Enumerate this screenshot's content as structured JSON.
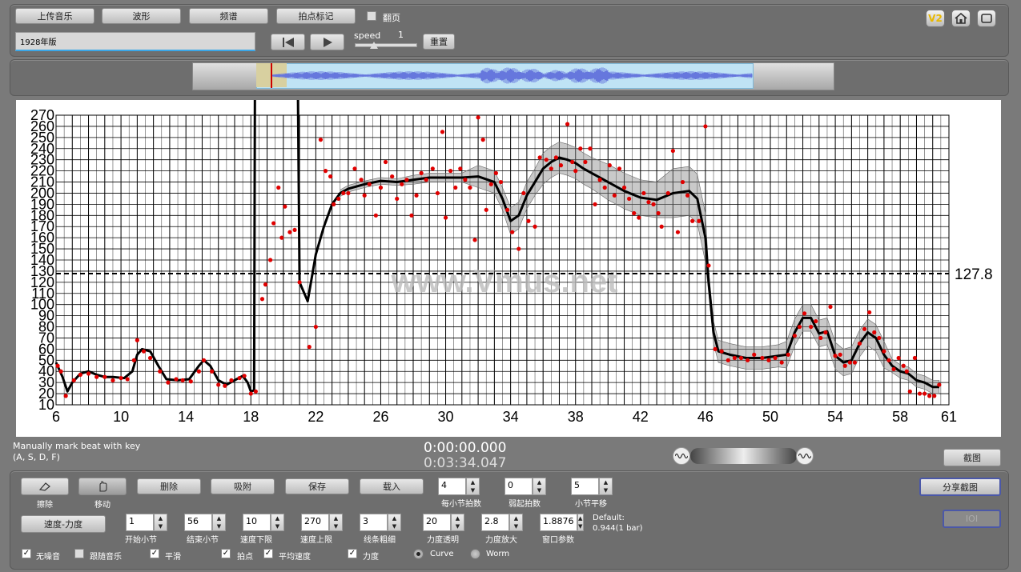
{
  "toolbar": {
    "upload_label": "上传音乐",
    "waveform_label": "波形",
    "spectrum_label": "频谱",
    "beatmark_label": "拍点标记",
    "flip_label": "翻页",
    "version_label": "V2",
    "title_value": "1928年版",
    "speed_label": "speed",
    "speed_value": "1",
    "reset_label": "重置"
  },
  "status": {
    "hint_line1": "Manually mark beat with key",
    "hint_line2": "(A, S, D, F)",
    "time_current": "0:00:00.000",
    "time_total": "0:03:34.047",
    "screenshot_label": "截图"
  },
  "controls": {
    "erase_label": "擦除",
    "move_label": "移动",
    "delete_label": "删除",
    "snap_label": "吸附",
    "save_label": "保存",
    "load_label": "载入",
    "beats_per_bar": {
      "value": "4",
      "label": "每小节拍数"
    },
    "pickup_beats": {
      "value": "0",
      "label": "弱起拍数"
    },
    "bar_shift": {
      "value": "5",
      "label": "小节平移"
    },
    "share_label": "分享截图",
    "ioi_label": "IOI",
    "mode_label": "速度-力度",
    "start_bar": {
      "value": "1",
      "label": "开始小节"
    },
    "end_bar": {
      "value": "56",
      "label": "结束小节"
    },
    "tempo_min": {
      "value": "10",
      "label": "速度下限"
    },
    "tempo_max": {
      "value": "270",
      "label": "速度上限"
    },
    "line_width": {
      "value": "3",
      "label": "线条粗细"
    },
    "dyn_alpha": {
      "value": "20",
      "label": "力度透明"
    },
    "dyn_scale": {
      "value": "2.8",
      "label": "力度放大"
    },
    "window_param": {
      "value": "1.8876",
      "label": "窗口参数"
    },
    "default_line1": "Default:",
    "default_line2": "0.944(1 bar)",
    "checks": {
      "no_noise": "无噪音",
      "follow_music": "跟随音乐",
      "smooth": "平滑",
      "beats": "拍点",
      "avg_tempo": "平均速度",
      "dynamics": "力度"
    },
    "curve_label": "Curve",
    "worm_label": "Worm"
  },
  "chart_data": {
    "type": "scatter",
    "title": "",
    "xlabel": "",
    "ylabel": "",
    "xlim": [
      6,
      61
    ],
    "ylim": [
      10,
      270
    ],
    "x_ticks": [
      6,
      10,
      14,
      18,
      22,
      26,
      30,
      34,
      38,
      42,
      46,
      50,
      54,
      58,
      61
    ],
    "y_ticks": [
      10,
      20,
      30,
      40,
      50,
      60,
      70,
      80,
      90,
      100,
      110,
      120,
      130,
      140,
      150,
      160,
      170,
      180,
      190,
      200,
      210,
      220,
      230,
      240,
      250,
      260,
      270
    ],
    "avg_tempo": 127.8,
    "avg_tempo_label": "127.8",
    "watermark": "www.Vmus.net",
    "grid": true,
    "smooth_curve": [
      [
        6,
        48
      ],
      [
        6.4,
        35
      ],
      [
        6.7,
        22
      ],
      [
        7,
        30
      ],
      [
        7.5,
        38
      ],
      [
        8,
        40
      ],
      [
        8.5,
        37
      ],
      [
        9,
        35
      ],
      [
        9.5,
        35
      ],
      [
        10.2,
        34
      ],
      [
        10.7,
        40
      ],
      [
        11,
        55
      ],
      [
        11.3,
        60
      ],
      [
        11.8,
        58
      ],
      [
        12.3,
        45
      ],
      [
        12.8,
        33
      ],
      [
        13.5,
        32
      ],
      [
        14.2,
        33
      ],
      [
        14.8,
        45
      ],
      [
        15.1,
        50
      ],
      [
        15.5,
        45
      ],
      [
        16,
        32
      ],
      [
        16.5,
        28
      ],
      [
        17,
        32
      ],
      [
        17.5,
        36
      ],
      [
        17.8,
        30
      ],
      [
        18,
        22
      ],
      [
        18.2,
        23
      ],
      [
        18.25,
        270
      ],
      [
        20.9,
        270
      ],
      [
        21,
        120
      ],
      [
        21.5,
        103
      ],
      [
        22,
        145
      ],
      [
        22.5,
        170
      ],
      [
        23,
        190
      ],
      [
        23.5,
        200
      ],
      [
        24,
        204
      ],
      [
        25,
        208
      ],
      [
        26,
        211
      ],
      [
        27,
        210
      ],
      [
        28,
        212
      ],
      [
        29,
        214
      ],
      [
        30,
        214
      ],
      [
        31,
        214
      ],
      [
        32,
        215
      ],
      [
        33,
        210
      ],
      [
        33.5,
        195
      ],
      [
        34,
        175
      ],
      [
        34.5,
        180
      ],
      [
        35,
        198
      ],
      [
        35.5,
        210
      ],
      [
        36,
        222
      ],
      [
        36.5,
        228
      ],
      [
        37,
        232
      ],
      [
        37.5,
        230
      ],
      [
        38,
        227
      ],
      [
        38.5,
        222
      ],
      [
        39,
        218
      ],
      [
        40,
        210
      ],
      [
        41,
        202
      ],
      [
        42,
        196
      ],
      [
        43,
        194
      ],
      [
        44,
        200
      ],
      [
        45,
        202
      ],
      [
        45.5,
        195
      ],
      [
        46,
        160
      ],
      [
        46.2,
        120
      ],
      [
        46.5,
        75
      ],
      [
        46.8,
        58
      ],
      [
        47.5,
        55
      ],
      [
        48.5,
        52
      ],
      [
        49.5,
        52
      ],
      [
        50.5,
        54
      ],
      [
        51,
        55
      ],
      [
        51.5,
        75
      ],
      [
        52,
        88
      ],
      [
        52.5,
        88
      ],
      [
        53,
        74
      ],
      [
        53.5,
        76
      ],
      [
        54,
        54
      ],
      [
        54.5,
        48
      ],
      [
        55,
        50
      ],
      [
        55.5,
        65
      ],
      [
        56,
        75
      ],
      [
        56.5,
        70
      ],
      [
        57,
        55
      ],
      [
        57.5,
        45
      ],
      [
        58,
        40
      ],
      [
        58.5,
        38
      ],
      [
        59,
        32
      ],
      [
        59.5,
        30
      ],
      [
        60,
        26
      ],
      [
        60.4,
        26
      ]
    ],
    "band_halfwidth": [
      [
        46.8,
        10
      ],
      [
        52,
        10
      ],
      [
        56,
        10
      ],
      [
        57.5,
        6
      ],
      [
        46,
        22
      ],
      [
        44,
        22
      ],
      [
        40,
        15
      ],
      [
        37,
        18
      ],
      [
        34,
        12
      ],
      [
        32,
        6
      ],
      [
        29,
        3
      ]
    ],
    "points": [
      [
        6.1,
        45
      ],
      [
        6.3,
        40
      ],
      [
        6.6,
        18
      ],
      [
        7.1,
        32
      ],
      [
        7.5,
        37
      ],
      [
        8,
        38
      ],
      [
        8.5,
        35
      ],
      [
        9,
        35
      ],
      [
        9.5,
        32
      ],
      [
        10,
        34
      ],
      [
        10.4,
        33
      ],
      [
        10.8,
        50
      ],
      [
        11,
        68
      ],
      [
        11.4,
        58
      ],
      [
        11.8,
        52
      ],
      [
        12.4,
        40
      ],
      [
        12.9,
        30
      ],
      [
        13.4,
        33
      ],
      [
        13.8,
        32
      ],
      [
        14.3,
        31
      ],
      [
        14.8,
        40
      ],
      [
        15.1,
        50
      ],
      [
        15.6,
        40
      ],
      [
        16,
        28
      ],
      [
        16.4,
        27
      ],
      [
        16.8,
        32
      ],
      [
        17.3,
        34
      ],
      [
        17.6,
        36
      ],
      [
        18,
        20
      ],
      [
        18.3,
        22
      ],
      [
        18.7,
        105
      ],
      [
        18.9,
        118
      ],
      [
        19.2,
        140
      ],
      [
        19.4,
        173
      ],
      [
        19.7,
        205
      ],
      [
        19.9,
        160
      ],
      [
        20.1,
        188
      ],
      [
        20.4,
        165
      ],
      [
        20.7,
        167
      ],
      [
        21,
        120
      ],
      [
        21.6,
        62
      ],
      [
        22,
        80
      ],
      [
        22.3,
        248
      ],
      [
        22.6,
        220
      ],
      [
        22.9,
        215
      ],
      [
        23.1,
        190
      ],
      [
        23.4,
        195
      ],
      [
        23.7,
        200
      ],
      [
        24,
        200
      ],
      [
        24.4,
        222
      ],
      [
        24.8,
        212
      ],
      [
        25,
        198
      ],
      [
        25.3,
        208
      ],
      [
        25.7,
        180
      ],
      [
        26,
        205
      ],
      [
        26.3,
        228
      ],
      [
        26.7,
        215
      ],
      [
        27,
        195
      ],
      [
        27.3,
        208
      ],
      [
        27.6,
        212
      ],
      [
        27.9,
        180
      ],
      [
        28.2,
        198
      ],
      [
        28.5,
        218
      ],
      [
        28.8,
        212
      ],
      [
        29.2,
        222
      ],
      [
        29.5,
        200
      ],
      [
        29.8,
        255
      ],
      [
        30,
        178
      ],
      [
        30.3,
        220
      ],
      [
        30.6,
        205
      ],
      [
        30.9,
        222
      ],
      [
        31.2,
        212
      ],
      [
        31.5,
        205
      ],
      [
        31.8,
        158
      ],
      [
        32,
        268
      ],
      [
        32.3,
        248
      ],
      [
        32.5,
        185
      ],
      [
        32.8,
        208
      ],
      [
        33.1,
        218
      ],
      [
        33.4,
        210
      ],
      [
        33.8,
        185
      ],
      [
        34.1,
        165
      ],
      [
        34.5,
        150
      ],
      [
        34.8,
        200
      ],
      [
        35.1,
        175
      ],
      [
        35.5,
        170
      ],
      [
        35.8,
        232
      ],
      [
        36.2,
        230
      ],
      [
        36.5,
        222
      ],
      [
        36.8,
        232
      ],
      [
        37.1,
        225
      ],
      [
        37.5,
        262
      ],
      [
        37.8,
        228
      ],
      [
        38,
        220
      ],
      [
        38.3,
        240
      ],
      [
        38.6,
        228
      ],
      [
        38.9,
        240
      ],
      [
        39.2,
        190
      ],
      [
        39.5,
        212
      ],
      [
        39.8,
        205
      ],
      [
        40.1,
        225
      ],
      [
        40.4,
        198
      ],
      [
        40.7,
        222
      ],
      [
        41,
        205
      ],
      [
        41.3,
        195
      ],
      [
        41.6,
        182
      ],
      [
        41.9,
        178
      ],
      [
        42.2,
        200
      ],
      [
        42.5,
        192
      ],
      [
        42.8,
        190
      ],
      [
        43.1,
        182
      ],
      [
        43.3,
        170
      ],
      [
        43.7,
        200
      ],
      [
        44,
        238
      ],
      [
        44.3,
        165
      ],
      [
        44.6,
        210
      ],
      [
        44.9,
        198
      ],
      [
        45.2,
        175
      ],
      [
        45.6,
        175
      ],
      [
        46,
        260
      ],
      [
        46.2,
        135
      ],
      [
        46.6,
        60
      ],
      [
        47,
        58
      ],
      [
        47.4,
        50
      ],
      [
        47.8,
        52
      ],
      [
        48.2,
        52
      ],
      [
        48.6,
        50
      ],
      [
        49,
        55
      ],
      [
        49.5,
        52
      ],
      [
        49.9,
        50
      ],
      [
        50.3,
        52
      ],
      [
        50.7,
        48
      ],
      [
        51.1,
        55
      ],
      [
        51.5,
        72
      ],
      [
        51.8,
        80
      ],
      [
        52.1,
        92
      ],
      [
        52.5,
        80
      ],
      [
        52.8,
        85
      ],
      [
        53.1,
        70
      ],
      [
        53.4,
        75
      ],
      [
        53.7,
        98
      ],
      [
        54,
        54
      ],
      [
        54.3,
        55
      ],
      [
        54.6,
        45
      ],
      [
        54.9,
        48
      ],
      [
        55.2,
        48
      ],
      [
        55.5,
        65
      ],
      [
        55.8,
        78
      ],
      [
        56.1,
        93
      ],
      [
        56.4,
        75
      ],
      [
        56.7,
        70
      ],
      [
        57,
        58
      ],
      [
        57.3,
        50
      ],
      [
        57.6,
        42
      ],
      [
        57.9,
        52
      ],
      [
        58.2,
        45
      ],
      [
        58.4,
        40
      ],
      [
        58.6,
        22
      ],
      [
        58.9,
        52
      ],
      [
        59.2,
        20
      ],
      [
        59.5,
        20
      ],
      [
        59.8,
        18
      ],
      [
        60.1,
        18
      ],
      [
        60.4,
        28
      ]
    ]
  }
}
